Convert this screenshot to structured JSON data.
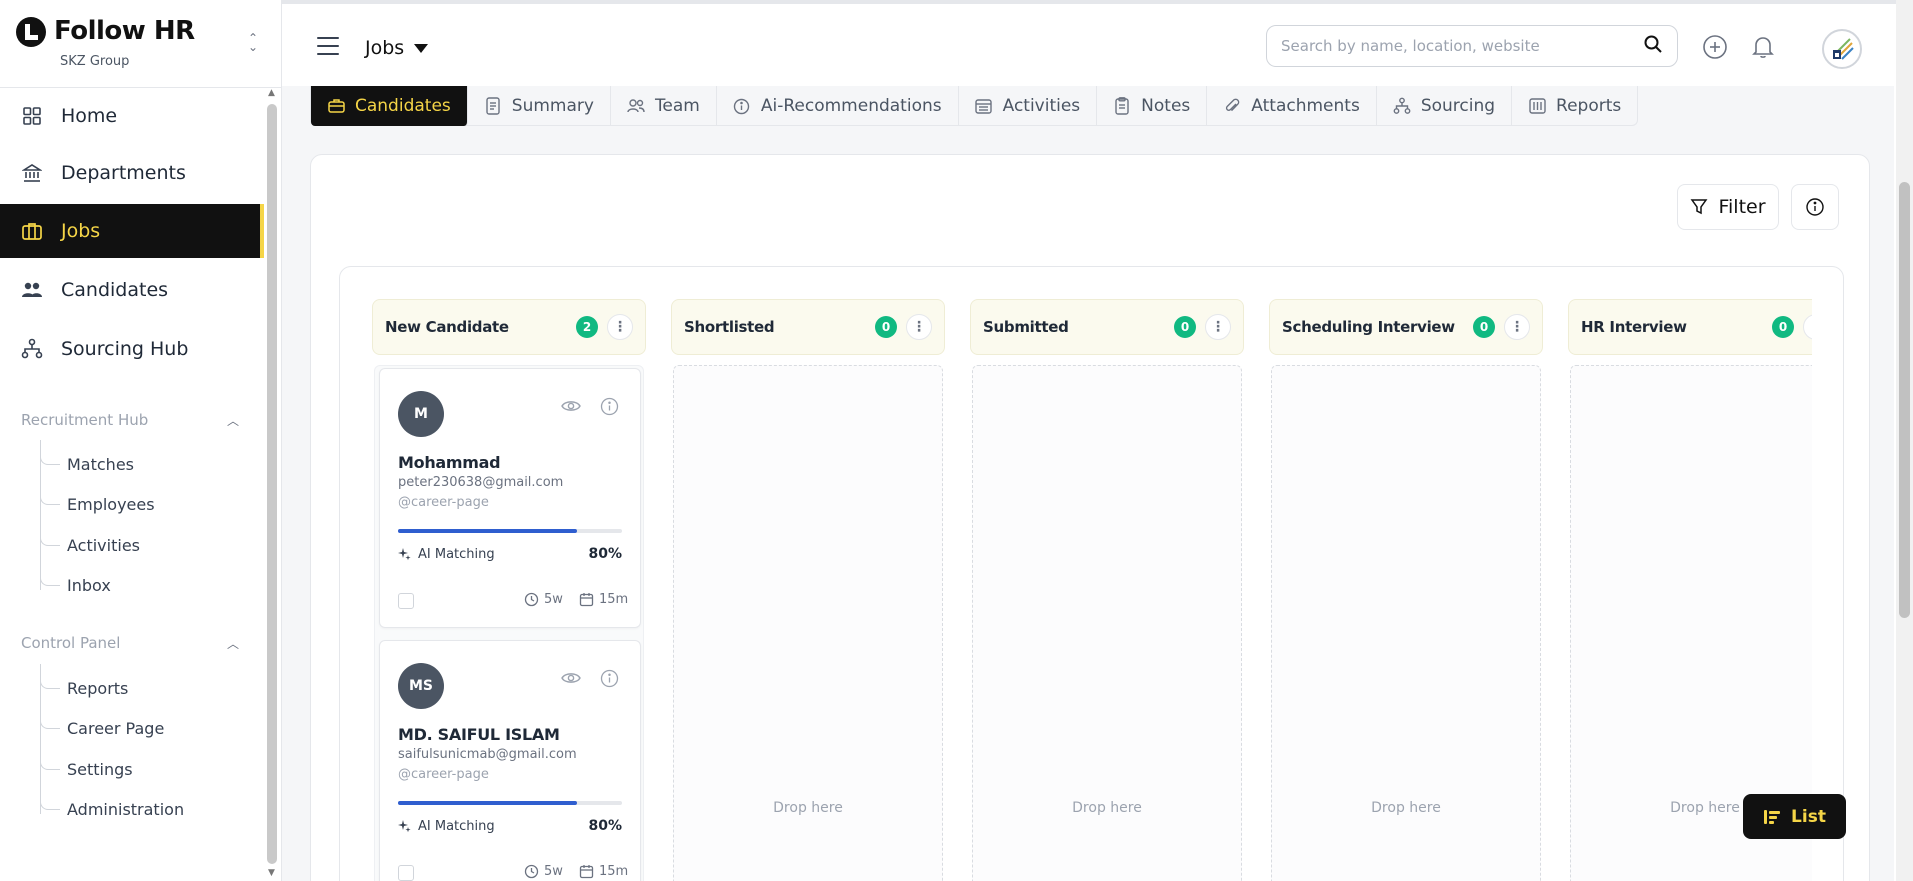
{
  "brand": {
    "name": "Follow HR",
    "org": "SKZ Group"
  },
  "sidebar": {
    "items": [
      {
        "label": "Home",
        "icon": "grid-icon"
      },
      {
        "label": "Departments",
        "icon": "bank-icon"
      },
      {
        "label": "Jobs",
        "icon": "briefcase-icon"
      },
      {
        "label": "Candidates",
        "icon": "users-icon"
      },
      {
        "label": "Sourcing Hub",
        "icon": "hierarchy-icon"
      }
    ],
    "recruitment_title": "Recruitment Hub",
    "recruitment_items": [
      "Matches",
      "Employees",
      "Activities",
      "Inbox"
    ],
    "control_title": "Control Panel",
    "control_items": [
      "Reports",
      "Career Page",
      "Settings",
      "Administration"
    ]
  },
  "topbar": {
    "section": "Jobs",
    "search_placeholder": "Search by name, location, website"
  },
  "tabs": [
    {
      "label": "Candidates",
      "icon": "briefcase-icon"
    },
    {
      "label": "Summary",
      "icon": "document-icon"
    },
    {
      "label": "Team",
      "icon": "team-icon"
    },
    {
      "label": "Ai-Recommendations",
      "icon": "info-icon"
    },
    {
      "label": "Activities",
      "icon": "calendar-icon"
    },
    {
      "label": "Notes",
      "icon": "notes-icon"
    },
    {
      "label": "Attachments",
      "icon": "paperclip-icon"
    },
    {
      "label": "Sourcing",
      "icon": "hierarchy-icon"
    },
    {
      "label": "Reports",
      "icon": "report-icon"
    }
  ],
  "toolbar": {
    "filter_label": "Filter"
  },
  "board": {
    "columns": [
      {
        "title": "New Candidate",
        "count": "2"
      },
      {
        "title": "Shortlisted",
        "count": "0"
      },
      {
        "title": "Submitted",
        "count": "0"
      },
      {
        "title": "Scheduling Interview",
        "count": "0"
      },
      {
        "title": "HR Interview",
        "count": "0"
      }
    ],
    "drop_label": "Drop here",
    "cards": [
      {
        "initials": "M",
        "name": "Mohammad",
        "email": "peter230638@gmail.com",
        "source": "@career-page",
        "match_label": "AI Matching",
        "match_pct": "80%",
        "match_value": 0.8,
        "age": "5w",
        "duration": "15m"
      },
      {
        "initials": "MS",
        "name": "MD. SAIFUL ISLAM",
        "email": "saifulsunicmab@gmail.com",
        "source": "@career-page",
        "match_label": "AI Matching",
        "match_pct": "80%",
        "match_value": 0.8,
        "age": "5w",
        "duration": "15m"
      }
    ]
  },
  "list_button": {
    "label": "List"
  },
  "colors": {
    "accent": "#f5d547",
    "dark": "#111111",
    "success": "#10b981",
    "progress": "#2f5ecf"
  }
}
